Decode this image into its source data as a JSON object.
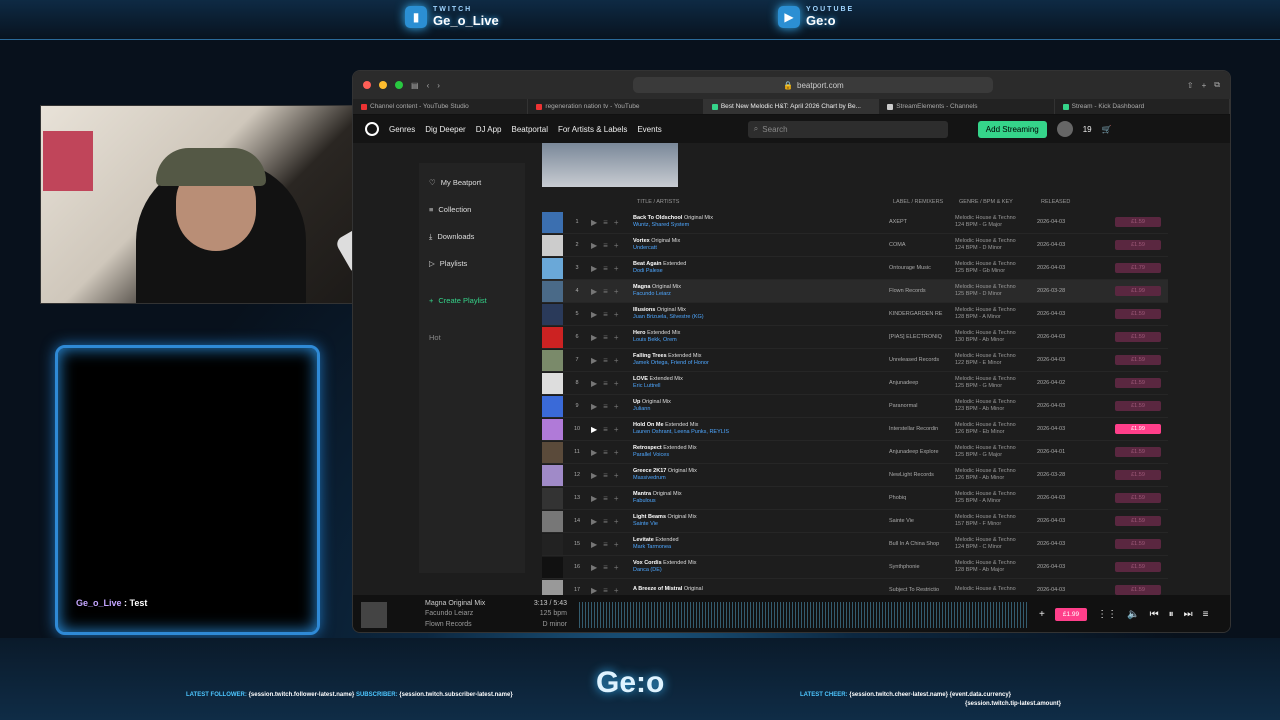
{
  "overlay": {
    "twitch_label": "TWITCH",
    "twitch_name": "Ge_o_Live",
    "youtube_label": "YOUTUBE",
    "youtube_name": "Ge:o",
    "brand": "Ge:o",
    "chat": {
      "user": "Ge_o_Live",
      "msg": " : Test"
    },
    "ticker_left": {
      "k1": "LATEST FOLLOWER:",
      "v1": "{session.twitch.follower-latest.name}",
      "k2": "SUBSCRIBER:",
      "v2": "{session.twitch.subscriber-latest.name}"
    },
    "ticker_right": {
      "k1": "LATEST CHEER:",
      "v1": "{session.twitch.cheer-latest.name}",
      "v2": "{event.data.currency}",
      "v3": "{session.twitch.tip-latest.amount}"
    }
  },
  "browser": {
    "url": "beatport.com",
    "tabs": [
      {
        "label": "Channel content - YouTube Studio",
        "color": "#e33"
      },
      {
        "label": "regeneration nation tv - YouTube",
        "color": "#e33"
      },
      {
        "label": "Best New Melodic H&T: April 2026 Chart by Be...",
        "color": "#35d48a",
        "active": true
      },
      {
        "label": "StreamElements - Channels",
        "color": "#ccc"
      },
      {
        "label": "Stream - Kick Dashboard",
        "color": "#35d48a"
      }
    ]
  },
  "nav": {
    "items": [
      "Genres",
      "Dig Deeper",
      "DJ App",
      "Beatportal",
      "For Artists & Labels",
      "Events"
    ],
    "search_placeholder": "Search",
    "add_streaming": "Add Streaming",
    "cart_count": "19"
  },
  "sidebar": {
    "items": [
      "My Beatport",
      "Collection",
      "Downloads",
      "Playlists"
    ],
    "create": "Create Playlist",
    "hot": "Hot"
  },
  "table": {
    "headers": [
      "TITLE / ARTISTS",
      "LABEL / REMIXERS",
      "GENRE / BPM & KEY",
      "RELEASED"
    ],
    "rows": [
      {
        "n": "1",
        "title": "Back To Oldschool",
        "mix": "Original Mix",
        "artist": "Wuntz, Shared System",
        "label": "AXEPT",
        "genre": "Melodic House & Techno",
        "bpm": "124 BPM - G Major",
        "date": "2026-04-03",
        "price": "£1.59",
        "art": "#3b6fb0"
      },
      {
        "n": "2",
        "title": "Vortex",
        "mix": "Original Mix",
        "artist": "Undercatt",
        "label": "COMA",
        "genre": "Melodic House & Techno",
        "bpm": "124 BPM - D Minor",
        "date": "2026-04-03",
        "price": "£1.59",
        "art": "#ccc"
      },
      {
        "n": "3",
        "title": "Beat Again",
        "mix": "Extended",
        "artist": "Dodi Palese",
        "label": "Ontourage Music",
        "genre": "Melodic House & Techno",
        "bpm": "125 BPM - Gb Minor",
        "date": "2026-04-03",
        "price": "£1.79",
        "art": "#6aa8d8"
      },
      {
        "n": "4",
        "title": "Magna",
        "mix": "Original Mix",
        "artist": "Facundo Leiarz",
        "label": "Flown Records",
        "genre": "Melodic House & Techno",
        "bpm": "125 BPM - D Minor",
        "date": "2026-03-28",
        "price": "£1.99",
        "art": "#4a6a88",
        "hl": true
      },
      {
        "n": "5",
        "title": "Illusions",
        "mix": "Original Mix",
        "artist": "Juan Brizuela, Silvestre (KG)",
        "label": "KINDERGARDEN RE",
        "genre": "Melodic House & Techno",
        "bpm": "128 BPM - A Minor",
        "date": "2026-04-03",
        "price": "£1.59",
        "art": "#2a3a5a"
      },
      {
        "n": "6",
        "title": "Hero",
        "mix": "Extended Mix",
        "artist": "Louis Bekk, Orem",
        "label": "[PIAS] ELECTRONIQ",
        "genre": "Melodic House & Techno",
        "bpm": "130 BPM - Ab Minor",
        "date": "2026-04-03",
        "price": "£1.59",
        "art": "#c22"
      },
      {
        "n": "7",
        "title": "Falling Trees",
        "mix": "Extended Mix",
        "artist": "Jamek Ortega, Friend of Honor",
        "label": "Unreleased Records",
        "genre": "Melodic House & Techno",
        "bpm": "122 BPM - E Minor",
        "date": "2026-04-03",
        "price": "£1.59",
        "art": "#7a8a6a"
      },
      {
        "n": "8",
        "title": "LOVE",
        "mix": "Extended Mix",
        "artist": "Eric Luttrell",
        "label": "Anjunadeep",
        "genre": "Melodic House & Techno",
        "bpm": "125 BPM - G Minor",
        "date": "2026-04-02",
        "price": "£1.59",
        "art": "#ddd"
      },
      {
        "n": "9",
        "title": "Up",
        "mix": "Original Mix",
        "artist": "Juliann",
        "label": "Paranormal",
        "genre": "Melodic House & Techno",
        "bpm": "123 BPM - Ab Minor",
        "date": "2026-04-03",
        "price": "£1.59",
        "art": "#3a6ad8"
      },
      {
        "n": "10",
        "title": "Hold On Me",
        "mix": "Extended Mix",
        "artist": "Lauren Oshrant, Leena Punks, REYLIS",
        "label": "Interstellar Recordin",
        "genre": "Melodic House & Techno",
        "bpm": "126 BPM - Eb Minor",
        "date": "2026-04-03",
        "price": "£1.99",
        "art": "#b07ad8",
        "active": true
      },
      {
        "n": "11",
        "title": "Retrospect",
        "mix": "Extended Mix",
        "artist": "Parallel Voices",
        "label": "Anjunadeep Explore",
        "genre": "Melodic House & Techno",
        "bpm": "125 BPM - G Major",
        "date": "2026-04-01",
        "price": "£1.59",
        "art": "#5a4a3a"
      },
      {
        "n": "12",
        "title": "Greece 2K17",
        "mix": "Original Mix",
        "artist": "Massivedrum",
        "label": "NewLight Records",
        "genre": "Melodic House & Techno",
        "bpm": "126 BPM - Ab Minor",
        "date": "2026-03-28",
        "price": "£1.59",
        "art": "#a08ac8"
      },
      {
        "n": "13",
        "title": "Mantra",
        "mix": "Original Mix",
        "artist": "Fabulous",
        "label": "Phobiq",
        "genre": "Melodic House & Techno",
        "bpm": "125 BPM - A Minor",
        "date": "2026-04-03",
        "price": "£1.59",
        "art": "#333"
      },
      {
        "n": "14",
        "title": "Light Beams",
        "mix": "Original Mix",
        "artist": "Sainte Vie",
        "label": "Sainte Vie",
        "genre": "Melodic House & Techno",
        "bpm": "157 BPM - F Minor",
        "date": "2026-04-03",
        "price": "£1.59",
        "art": "#777"
      },
      {
        "n": "15",
        "title": "Levitate",
        "mix": "Extended",
        "artist": "Mark Tarmonea",
        "label": "Bull In A China Shop",
        "genre": "Melodic House & Techno",
        "bpm": "124 BPM - C Minor",
        "date": "2026-04-03",
        "price": "£1.59",
        "art": "#222"
      },
      {
        "n": "16",
        "title": "Vox Cordis",
        "mix": "Extended Mix",
        "artist": "Danca (DE)",
        "label": "Synthphonie",
        "genre": "Melodic House & Techno",
        "bpm": "128 BPM - Ab Major",
        "date": "2026-04-03",
        "price": "£1.59",
        "art": "#111"
      },
      {
        "n": "17",
        "title": "A Breeze of Mistral",
        "mix": "Original",
        "artist": "",
        "label": "Subject To Restrictio",
        "genre": "Melodic House & Techno",
        "bpm": "",
        "date": "2026-04-03",
        "price": "£1.59",
        "art": "#999"
      }
    ]
  },
  "player": {
    "title": "Magna Original Mix",
    "artist": "Facundo Leiarz",
    "label": "Flown Records",
    "time": "3:13 / 5:43",
    "bpm": "125 bpm",
    "key": "D minor",
    "price": "£1.99"
  }
}
